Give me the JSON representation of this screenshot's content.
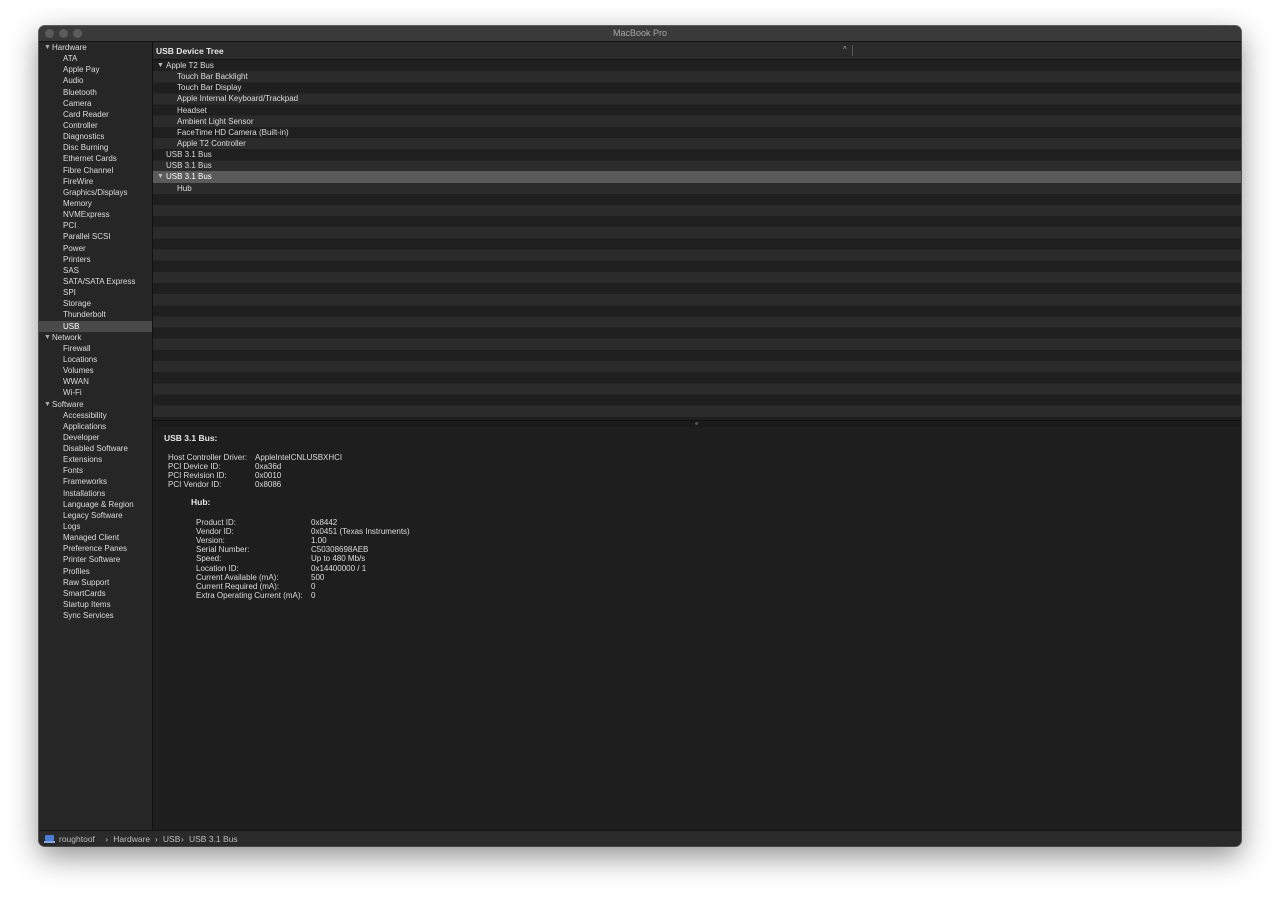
{
  "window": {
    "title": "MacBook Pro"
  },
  "sidebar": {
    "groups": [
      {
        "label": "Hardware",
        "items": [
          "ATA",
          "Apple Pay",
          "Audio",
          "Bluetooth",
          "Camera",
          "Card Reader",
          "Controller",
          "Diagnostics",
          "Disc Burning",
          "Ethernet Cards",
          "Fibre Channel",
          "FireWire",
          "Graphics/Displays",
          "Memory",
          "NVMExpress",
          "PCI",
          "Parallel SCSI",
          "Power",
          "Printers",
          "SAS",
          "SATA/SATA Express",
          "SPI",
          "Storage",
          "Thunderbolt",
          "USB"
        ]
      },
      {
        "label": "Network",
        "items": [
          "Firewall",
          "Locations",
          "Volumes",
          "WWAN",
          "Wi-Fi"
        ]
      },
      {
        "label": "Software",
        "items": [
          "Accessibility",
          "Applications",
          "Developer",
          "Disabled Software",
          "Extensions",
          "Fonts",
          "Frameworks",
          "Installations",
          "Language & Region",
          "Legacy Software",
          "Logs",
          "Managed Client",
          "Preference Panes",
          "Printer Software",
          "Profiles",
          "Raw Support",
          "SmartCards",
          "Startup Items",
          "Sync Services"
        ]
      }
    ],
    "selected": "USB"
  },
  "tree": {
    "header": "USB Device Tree",
    "rows": [
      {
        "label": "Apple T2 Bus",
        "level": 0,
        "expanded": true
      },
      {
        "label": "Touch Bar Backlight",
        "level": 1
      },
      {
        "label": "Touch Bar Display",
        "level": 1
      },
      {
        "label": "Apple Internal Keyboard/Trackpad",
        "level": 1
      },
      {
        "label": "Headset",
        "level": 1
      },
      {
        "label": "Ambient Light Sensor",
        "level": 1
      },
      {
        "label": "FaceTime HD Camera (Built-in)",
        "level": 1
      },
      {
        "label": "Apple T2 Controller",
        "level": 1
      },
      {
        "label": "USB 3.1 Bus",
        "level": 0
      },
      {
        "label": "USB 3.1 Bus",
        "level": 0
      },
      {
        "label": "USB 3.1 Bus",
        "level": 0,
        "expanded": true,
        "selected": true
      },
      {
        "label": "Hub",
        "level": 1
      }
    ]
  },
  "detail": {
    "title": "USB 3.1 Bus:",
    "bus_props": [
      {
        "key": "Host Controller Driver:",
        "value": "AppleIntelCNLUSBXHCI"
      },
      {
        "key": "PCI Device ID:",
        "value": "0xa36d"
      },
      {
        "key": "PCI Revision ID:",
        "value": "0x0010"
      },
      {
        "key": "PCI Vendor ID:",
        "value": "0x8086"
      }
    ],
    "hub_title": "Hub:",
    "hub_props": [
      {
        "key": "Product ID:",
        "value": "0x8442"
      },
      {
        "key": "Vendor ID:",
        "value": "0x0451  (Texas Instruments)"
      },
      {
        "key": "Version:",
        "value": "1.00"
      },
      {
        "key": "Serial Number:",
        "value": "C50308698AEB"
      },
      {
        "key": "Speed:",
        "value": "Up to 480 Mb/s"
      },
      {
        "key": "Location ID:",
        "value": "0x14400000 / 1"
      },
      {
        "key": "Current Available (mA):",
        "value": "500"
      },
      {
        "key": "Current Required (mA):",
        "value": "0"
      },
      {
        "key": "Extra Operating Current (mA):",
        "value": "0"
      }
    ]
  },
  "statusbar": {
    "icon": "computer-icon",
    "crumbs": [
      "roughtoof",
      "Hardware",
      "USB",
      "USB 3.1 Bus"
    ],
    "separator": "›"
  }
}
